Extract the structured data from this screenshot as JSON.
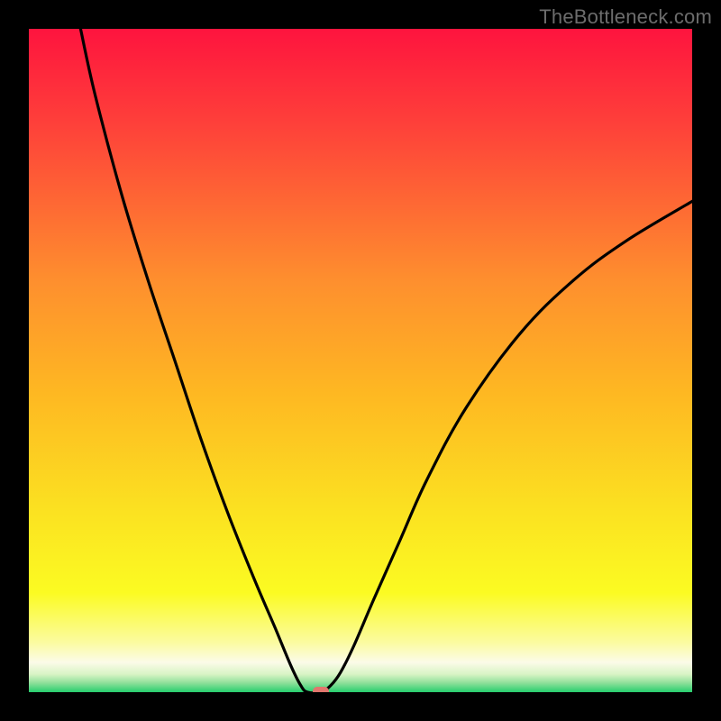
{
  "watermark": "TheBottleneck.com",
  "marker": {
    "color": "#e2766d"
  },
  "chart_data": {
    "type": "line",
    "title": "",
    "xlabel": "",
    "ylabel": "",
    "xlim": [
      0,
      1
    ],
    "ylim": [
      0,
      1
    ],
    "grid": false,
    "background_gradient": {
      "top": "#fe143e",
      "mid": "#fead23",
      "yellow": "#fbfb22",
      "light": "#fbfbd7",
      "bottom": "#26ce6e"
    },
    "optimum_point": {
      "x": 0.42,
      "y": 0.0
    },
    "marker_point": {
      "x": 0.44,
      "y": 0.002
    },
    "series": [
      {
        "name": "bottleneck-curve",
        "color": "#000000",
        "x": [
          0.078,
          0.1,
          0.14,
          0.18,
          0.22,
          0.26,
          0.3,
          0.34,
          0.37,
          0.395,
          0.41,
          0.42,
          0.44,
          0.455,
          0.47,
          0.49,
          0.52,
          0.56,
          0.6,
          0.66,
          0.74,
          0.82,
          0.9,
          1.0
        ],
        "y": [
          1.0,
          0.9,
          0.75,
          0.62,
          0.5,
          0.38,
          0.27,
          0.17,
          0.1,
          0.04,
          0.01,
          0.0,
          0.0,
          0.01,
          0.03,
          0.07,
          0.14,
          0.23,
          0.32,
          0.43,
          0.54,
          0.62,
          0.68,
          0.74
        ]
      }
    ]
  }
}
